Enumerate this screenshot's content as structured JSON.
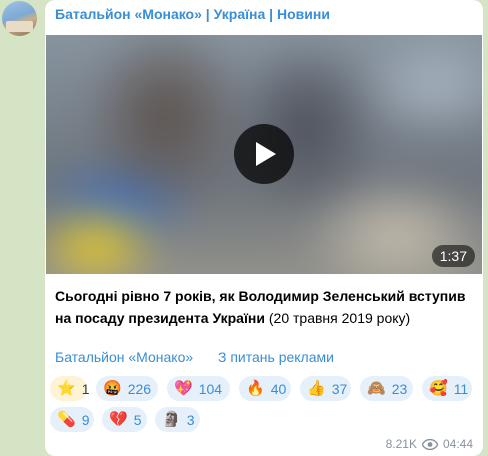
{
  "channel": {
    "name": "Батальйон «Монако» | Україна | Новини"
  },
  "video": {
    "duration": "1:37"
  },
  "post": {
    "bold_text": "Сьогодні рівно 7 років, як Володимир Зеленський вступив на посаду президента України",
    "normal_text": " (20 травня 2019 року)"
  },
  "links": {
    "channel_link": "Батальйон «Монако»",
    "ads_link": "З питань реклами"
  },
  "reactions": [
    {
      "emoji": "⭐",
      "count": "1",
      "icon": "star-icon"
    },
    {
      "emoji": "🤬",
      "count": "226",
      "icon": "angry-face-icon"
    },
    {
      "emoji": "💖",
      "count": "104",
      "icon": "sparkling-heart-icon"
    },
    {
      "emoji": "🔥",
      "count": "40",
      "icon": "fire-icon"
    },
    {
      "emoji": "👍",
      "count": "37",
      "icon": "thumbs-up-icon"
    },
    {
      "emoji": "🙈",
      "count": "23",
      "icon": "see-no-evil-monkey-icon"
    },
    {
      "emoji": "🥰",
      "count": "11",
      "icon": "smiling-hearts-face-icon"
    },
    {
      "emoji": "💊",
      "count": "9",
      "icon": "pill-icon"
    },
    {
      "emoji": "💔",
      "count": "5",
      "icon": "broken-heart-icon"
    },
    {
      "emoji": "🗿",
      "count": "3",
      "icon": "moai-icon"
    }
  ],
  "meta": {
    "views": "8.21K",
    "time": "04:44"
  }
}
